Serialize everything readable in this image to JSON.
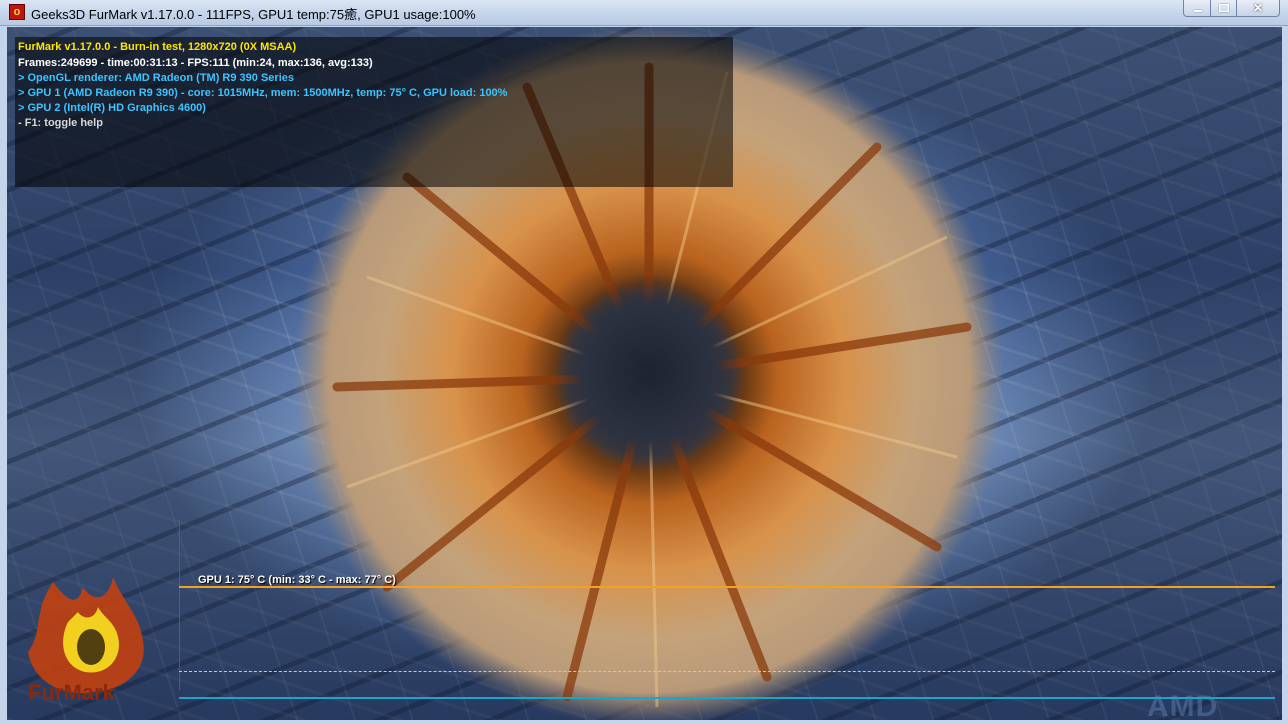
{
  "window": {
    "title": "Geeks3D FurMark v1.17.0.0 - 111FPS, GPU1 temp:75癒, GPU1 usage:100%",
    "minimize_glyph": "",
    "maximize_glyph": "",
    "close_glyph": "✕"
  },
  "osd": {
    "header": "FurMark v1.17.0.0 - Burn-in test, 1280x720 (0X MSAA)",
    "stats": "Frames:249699 - time:00:31:13 - FPS:111 (min:24, max:136, avg:133)",
    "renderer": "> OpenGL renderer: AMD Radeon (TM) R9 390 Series",
    "gpu1": "> GPU 1 (AMD Radeon R9 390) - core: 1015MHz, mem: 1500MHz, temp: 75° C, GPU load: 100%",
    "gpu2": "> GPU 2 (Intel(R) HD Graphics 4600)",
    "help": "- F1: toggle help"
  },
  "graph": {
    "label": "GPU 1: 75° C (min: 33° C - max: 77° C)",
    "current_temp_c": 75,
    "min_temp_c": 33,
    "max_temp_c": 77
  },
  "logos": {
    "furmark_logo": "FurMark",
    "amd_logo": "AMD"
  },
  "colors": {
    "osd_header": "#ffe600",
    "osd_info": "#3cc4ff",
    "graph_line": "#f4a020",
    "graph_axis": "#1aa6c8"
  }
}
